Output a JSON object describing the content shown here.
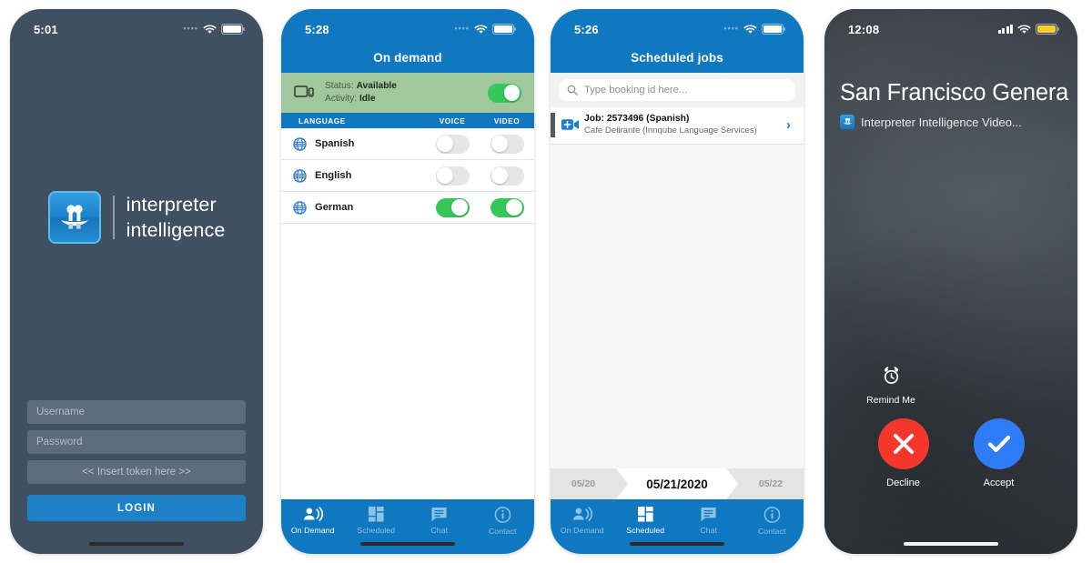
{
  "colors": {
    "brand_blue": "#1078c0",
    "login_bg": "#3f5063",
    "status_green": "#a1c79d",
    "toggle_on": "#36c759",
    "decline_red": "#f5372b",
    "accept_blue": "#2f7cf6",
    "battery_yellow": "#f5cf2e"
  },
  "login_screen": {
    "status_bar": {
      "time": "5:01",
      "signal": "signal-dots-icon",
      "wifi": "wifi-icon",
      "battery": "battery-icon"
    },
    "logo": {
      "mark": "interpreter-intelligence-logo-icon",
      "line1": "interpreter",
      "line2": "intelligence"
    },
    "username_placeholder": "Username",
    "password_placeholder": "Password",
    "token_text": "<< Insert token here >>",
    "login_label": "LOGIN"
  },
  "on_demand_screen": {
    "status_bar": {
      "time": "5:28",
      "signal": "signal-dots-icon",
      "wifi": "wifi-icon",
      "battery": "battery-icon"
    },
    "title": "On demand",
    "availability": {
      "icon": "monitor-icon",
      "status_label": "Status:",
      "status_value": "Available",
      "activity_label": "Activity:",
      "activity_value": "Idle",
      "toggle_on": true
    },
    "columns": {
      "language": "LANGUAGE",
      "voice": "VOICE",
      "video": "VIDEO"
    },
    "languages": [
      {
        "name": "Spanish",
        "icon": "globe-icon",
        "voice_on": false,
        "video_on": false
      },
      {
        "name": "English",
        "icon": "globe-icon",
        "voice_on": false,
        "video_on": false
      },
      {
        "name": "German",
        "icon": "globe-icon",
        "voice_on": true,
        "video_on": true
      }
    ],
    "tabs": [
      {
        "label": "On Demand",
        "icon": "person-speaking-icon",
        "active": true
      },
      {
        "label": "Scheduled",
        "icon": "grid-icon",
        "active": false
      },
      {
        "label": "Chat",
        "icon": "chat-bubble-icon",
        "active": false
      },
      {
        "label": "Contact",
        "icon": "info-circle-icon",
        "active": false
      }
    ]
  },
  "scheduled_screen": {
    "status_bar": {
      "time": "5:26",
      "signal": "signal-dots-icon",
      "wifi": "wifi-icon",
      "battery": "battery-icon"
    },
    "title": "Scheduled jobs",
    "search_placeholder": "Type booking id here...",
    "search_icon": "search-icon",
    "jobs": [
      {
        "icon": "video-call-icon",
        "title": "Job: 2573496 (Spanish)",
        "subtitle": "Cafe Delirante (Innqube Language Services)",
        "chevron": "chevron-right-icon"
      }
    ],
    "date_nav": {
      "prev": "05/20",
      "current": "05/21/2020",
      "next": "05/22"
    },
    "tabs": [
      {
        "label": "On Demand",
        "icon": "person-speaking-icon",
        "active": false
      },
      {
        "label": "Scheduled",
        "icon": "grid-icon",
        "active": true
      },
      {
        "label": "Chat",
        "icon": "chat-bubble-icon",
        "active": false
      },
      {
        "label": "Contact",
        "icon": "info-circle-icon",
        "active": false
      }
    ]
  },
  "incoming_call_screen": {
    "status_bar": {
      "time": "12:08",
      "signal": "signal-bars-icon",
      "wifi": "wifi-icon",
      "battery": "battery-icon"
    },
    "caller_name": "San Francisco Genera",
    "app_name": "Interpreter Intelligence Video...",
    "app_icon": "interpreter-intelligence-logo-icon",
    "remind": {
      "icon": "alarm-clock-icon",
      "label": "Remind Me"
    },
    "decline": {
      "icon": "close-icon",
      "label": "Decline"
    },
    "accept": {
      "icon": "check-icon",
      "label": "Accept"
    }
  }
}
